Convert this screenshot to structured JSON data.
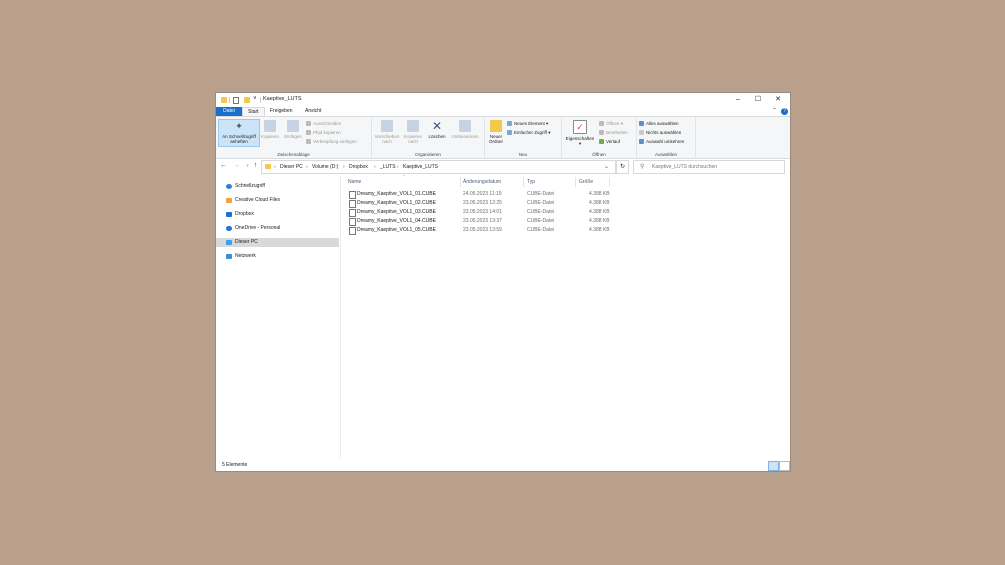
{
  "window": {
    "title": "Kaeptive_LUTS",
    "qat_dropdown": "∨"
  },
  "ribbon_tabs": [
    "Datei",
    "Start",
    "Freigeben",
    "Ansicht"
  ],
  "ribbon": {
    "zwischenablage": {
      "label": "Zwischenablage",
      "pin_label_1": "An Schnellzugriff",
      "pin_label_2": "anheften",
      "copy": "Kopieren",
      "paste": "Einfügen",
      "cut": "Ausschneiden",
      "copy_path": "Pfad kopieren",
      "paste_shortcut": "Verknüpfung einfügen"
    },
    "organisieren": {
      "label": "Organisieren",
      "move_1": "Verschieben",
      "move_2": "nach",
      "copyto_1": "Kopieren",
      "copyto_2": "nach",
      "delete": "Löschen",
      "rename": "Umbenennen"
    },
    "neu": {
      "label": "Neu",
      "new_folder_1": "Neuer",
      "new_folder_2": "Ordner",
      "new_item": "Neues Element",
      "easy_access": "Einfacher Zugriff"
    },
    "oeffnen": {
      "label": "Öffnen",
      "properties": "Eigenschaften",
      "open": "Öffnen",
      "edit": "Bearbeiten",
      "history": "Verlauf"
    },
    "auswaehlen": {
      "label": "Auswählen",
      "select_all": "Alles auswählen",
      "select_none": "Nichts auswählen",
      "invert": "Auswahl umkehren"
    }
  },
  "breadcrumb": [
    "Dieser PC",
    "Volume (D:)",
    "Dropbox",
    "_LUTS",
    "Kaeptive_LUTS"
  ],
  "search": {
    "placeholder": "Kaeptive_LUTS durchsuchen"
  },
  "nav_items": [
    {
      "label": "Schnellzugriff",
      "icon": "star-icon",
      "color": "#2d7fd8"
    },
    {
      "label": "Creative Cloud Files",
      "icon": "creative-cloud-icon",
      "color": "#f4a13a"
    },
    {
      "label": "Dropbox",
      "icon": "dropbox-icon",
      "color": "#1e6fd9"
    },
    {
      "label": "OneDrive - Personal",
      "icon": "onedrive-icon",
      "color": "#1e78d4"
    },
    {
      "label": "Dieser PC",
      "icon": "pc-icon",
      "color": "#3aa0e8"
    },
    {
      "label": "Netzwerk",
      "icon": "network-icon",
      "color": "#3a8fd6"
    }
  ],
  "columns": [
    "Name",
    "Änderungsdatum",
    "Typ",
    "Größe"
  ],
  "files": [
    {
      "name": "Dreamy_Kaeptive_VOL1_01.CUBE",
      "date": "24.05.2023 11:19",
      "type": "CUBE-Datei",
      "size": "4.388 KB"
    },
    {
      "name": "Dreamy_Kaeptive_VOL1_02.CUBE",
      "date": "23.05.2023 12:25",
      "type": "CUBE-Datei",
      "size": "4.388 KB"
    },
    {
      "name": "Dreamy_Kaeptive_VOL1_03.CUBE",
      "date": "23.05.2023 14:01",
      "type": "CUBE-Datei",
      "size": "4.388 KB"
    },
    {
      "name": "Dreamy_Kaeptive_VOL1_04.CUBE",
      "date": "23.05.2023 13:37",
      "type": "CUBE-Datei",
      "size": "4.388 KB"
    },
    {
      "name": "Dreamy_Kaeptive_VOL1_05.CUBE",
      "date": "23.05.2023 13:59",
      "type": "CUBE-Datei",
      "size": "4.388 KB"
    }
  ],
  "status": {
    "count": "5 Elemente"
  }
}
